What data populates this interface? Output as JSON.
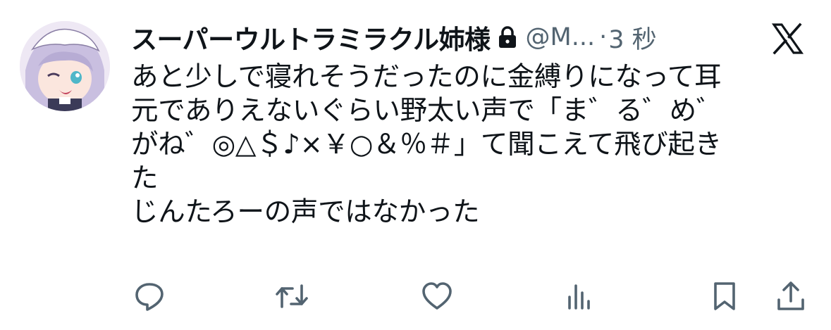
{
  "tweet": {
    "display_name": "スーパーウルトラミラクル姉様",
    "handle": "@M...",
    "separator": "·",
    "time": "3 秒",
    "body_lines": [
      "あと少しで寝れそうだったのに金縛りになって耳",
      "元でありえないぐらい野太い声で「ま゛る゛め゛",
      "がね゛◎△＄♪×￥○＆％＃」て聞こえて飛び起き",
      "た",
      "じんたろーの声ではなかった"
    ]
  },
  "icons": {
    "lock": "lock-icon",
    "platform": "x-logo-icon",
    "reply": "reply-icon",
    "repost": "repost-icon",
    "like": "like-icon",
    "views": "views-icon",
    "bookmark": "bookmark-icon",
    "share": "share-icon"
  },
  "colors": {
    "text": "#0f1419",
    "secondary": "#536471",
    "icon": "#536471",
    "background": "#ffffff"
  }
}
